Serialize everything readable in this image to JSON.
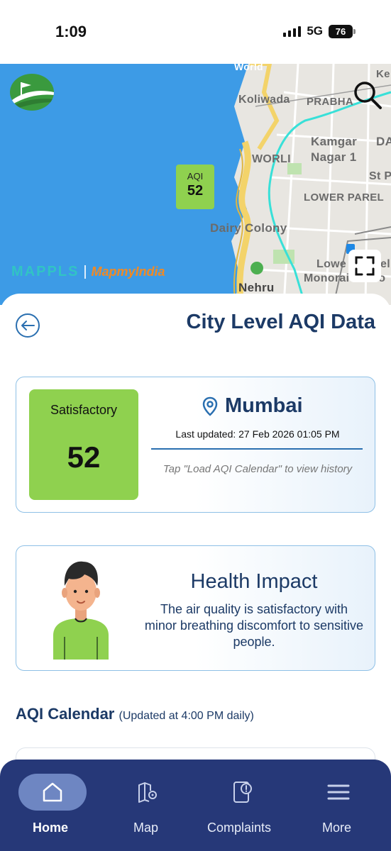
{
  "status_bar": {
    "time": "1:09",
    "network": "5G",
    "battery": "76"
  },
  "map": {
    "labels": [
      "Koliwada",
      "PRABHA",
      "Kamgar",
      "Nagar 1",
      "WORLI",
      "LOWER PAREL",
      "St P",
      "DA",
      "Dairy Colony",
      "Lowe",
      "el",
      "Monorai Statio",
      "Nehru",
      "Ke",
      "World"
    ],
    "marker": {
      "label": "AQI",
      "value": "52"
    },
    "brand": {
      "mappls": "MAPPLS",
      "mapmyindia": "MapmyIndia"
    }
  },
  "header": {
    "title": "City Level AQI Data"
  },
  "aqi_card": {
    "category": "Satisfactory",
    "value": "52",
    "city": "Mumbai",
    "last_updated": "Last updated: 27 Feb 2026 01:05 PM",
    "hint": "Tap \"Load AQI Calendar\" to view history",
    "color": "#8fd14f"
  },
  "health": {
    "title": "Health Impact",
    "text": "The air quality is satisfactory with minor breathing discomfort to sensitive people."
  },
  "calendar": {
    "title": "AQI Calendar",
    "subtitle": "(Updated at 4:00 PM daily)"
  },
  "nav": {
    "items": [
      {
        "label": "Home",
        "icon": "home-icon"
      },
      {
        "label": "Map",
        "icon": "map-pin-icon"
      },
      {
        "label": "Complaints",
        "icon": "complaint-icon"
      },
      {
        "label": "More",
        "icon": "menu-icon"
      }
    ]
  },
  "colors": {
    "primary": "#1c3a66",
    "accent": "#2a6fb0",
    "nav": "#263878",
    "satisfactory": "#8fd14f"
  }
}
